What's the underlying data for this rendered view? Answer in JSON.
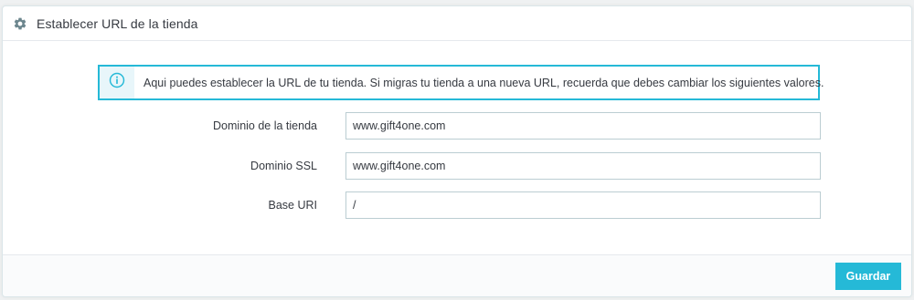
{
  "panel": {
    "title": "Establecer URL de la tienda",
    "title_icon": "gear-icon"
  },
  "alert": {
    "icon": "info-circle-icon",
    "message": "Aqui puedes establecer la URL de tu tienda. Si migras tu tienda a una nueva URL, recuerda que debes cambiar los siguientes valores."
  },
  "form": {
    "fields": [
      {
        "label": "Dominio de la tienda",
        "value": "www.gift4one.com"
      },
      {
        "label": "Dominio SSL",
        "value": "www.gift4one.com"
      },
      {
        "label": "Base URI",
        "value": "/"
      }
    ]
  },
  "footer": {
    "save_label": "Guardar"
  },
  "colors": {
    "accent": "#25b9d7",
    "text": "#363a41",
    "input_border": "#bbcdd2",
    "background": "#eff1f2"
  }
}
